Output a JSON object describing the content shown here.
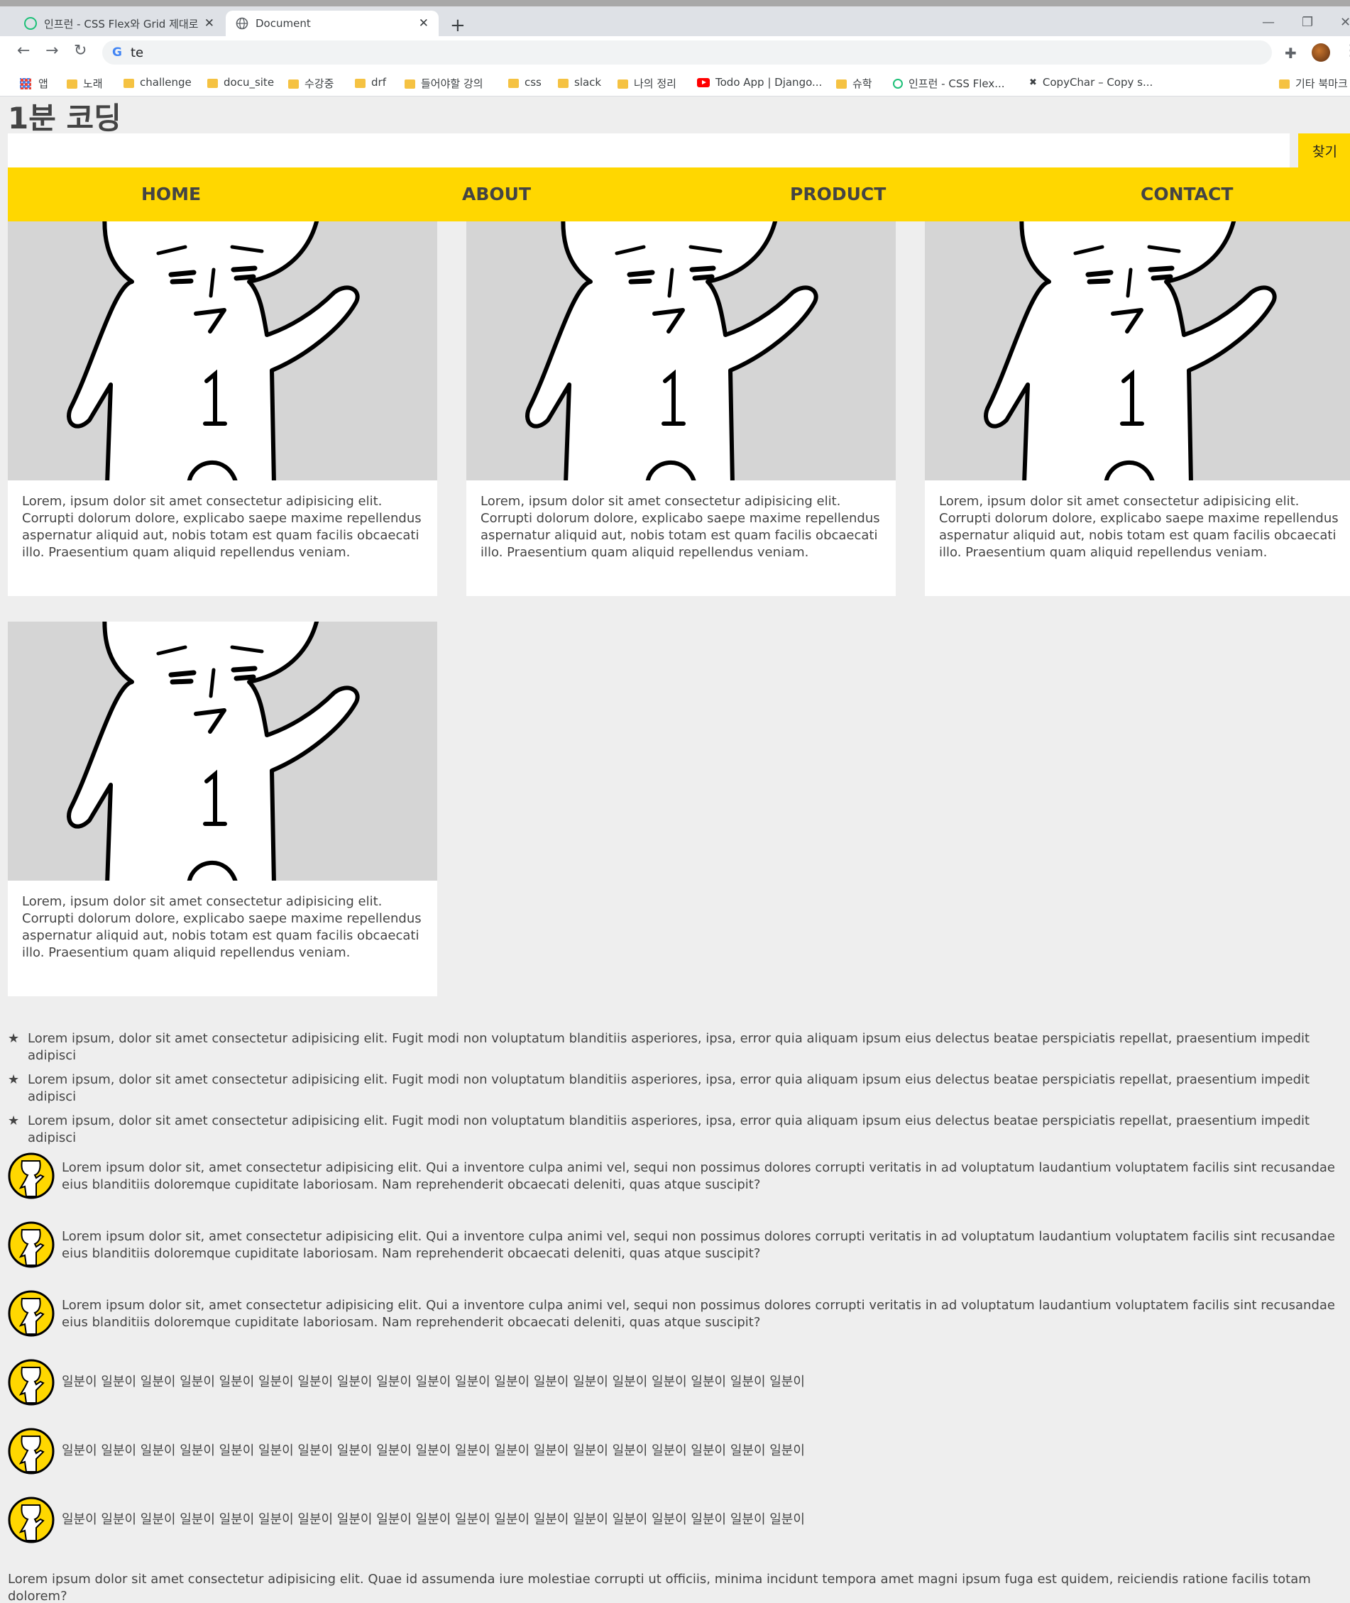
{
  "browser": {
    "tabs": [
      {
        "title": "인프런 - CSS Flex와 Grid 제대로",
        "active": false
      },
      {
        "title": "Document",
        "active": true
      }
    ],
    "address": "te",
    "bookmarks": [
      "앱",
      "노래",
      "challenge",
      "docu_site",
      "수강중",
      "drf",
      "들어야할 강의",
      "css",
      "slack",
      "나의 정리",
      "Todo App | Django...",
      "슈학",
      "인프런 - CSS Flex...",
      "CopyChar – Copy s...",
      "기타 북마크"
    ]
  },
  "page": {
    "title": "1분 코딩",
    "search": {
      "value": "",
      "button": "찾기"
    },
    "nav": [
      "HOME",
      "ABOUT",
      "PRODUCT",
      "CONTACT"
    ],
    "cards": [
      {
        "text": "Lorem, ipsum dolor sit amet consectetur adipisicing elit. Corrupti dolorum dolore, explicabo saepe maxime repellendus aspernatur aliquid aut, nobis totam est quam facilis obcaecati illo. Praesentium quam aliquid repellendus veniam."
      },
      {
        "text": "Lorem, ipsum dolor sit amet consectetur adipisicing elit. Corrupti dolorum dolore, explicabo saepe maxime repellendus aspernatur aliquid aut, nobis totam est quam facilis obcaecati illo. Praesentium quam aliquid repellendus veniam."
      },
      {
        "text": "Lorem, ipsum dolor sit amet consectetur adipisicing elit. Corrupti dolorum dolore, explicabo saepe maxime repellendus aspernatur aliquid aut, nobis totam est quam facilis obcaecati illo. Praesentium quam aliquid repellendus veniam."
      },
      {
        "text": "Lorem, ipsum dolor sit amet consectetur adipisicing elit. Corrupti dolorum dolore, explicabo saepe maxime repellendus aspernatur aliquid aut, nobis totam est quam facilis obcaecati illo. Praesentium quam aliquid repellendus veniam."
      }
    ],
    "star_list": [
      "Lorem ipsum, dolor sit amet consectetur adipisicing elit. Fugit modi non voluptatum blanditiis asperiores, ipsa, error quia aliquam ipsum eius delectus beatae perspiciatis repellat, praesentium impedit adipisci",
      "Lorem ipsum, dolor sit amet consectetur adipisicing elit. Fugit modi non voluptatum blanditiis asperiores, ipsa, error quia aliquam ipsum eius delectus beatae perspiciatis repellat, praesentium impedit adipisci",
      "Lorem ipsum, dolor sit amet consectetur adipisicing elit. Fugit modi non voluptatum blanditiis asperiores, ipsa, error quia aliquam ipsum eius delectus beatae perspiciatis repellat, praesentium impedit adipisci"
    ],
    "avatar_items": [
      "Lorem ipsum dolor sit, amet consectetur adipisicing elit. Qui a inventore culpa animi vel, sequi non possimus dolores corrupti veritatis in ad voluptatum laudantium voluptatem facilis sint recusandae eius blanditiis doloremque cupiditate laboriosam. Nam reprehenderit obcaecati deleniti, quas atque suscipit?",
      "Lorem ipsum dolor sit, amet consectetur adipisicing elit. Qui a inventore culpa animi vel, sequi non possimus dolores corrupti veritatis in ad voluptatum laudantium voluptatem facilis sint recusandae eius blanditiis doloremque cupiditate laboriosam. Nam reprehenderit obcaecati deleniti, quas atque suscipit?",
      "Lorem ipsum dolor sit, amet consectetur adipisicing elit. Qui a inventore culpa animi vel, sequi non possimus dolores corrupti veritatis in ad voluptatum laudantium voluptatem facilis sint recusandae eius blanditiis doloremque cupiditate laboriosam. Nam reprehenderit obcaecati deleniti, quas atque suscipit?",
      "일분이 일분이 일분이 일분이 일분이 일분이 일분이 일분이 일분이 일분이 일분이 일분이 일분이 일분이 일분이 일분이 일분이 일분이 일분이",
      "일분이 일분이 일분이 일분이 일분이 일분이 일분이 일분이 일분이 일분이 일분이 일분이 일분이 일분이 일분이 일분이 일분이 일분이 일분이",
      "일분이 일분이 일분이 일분이 일분이 일분이 일분이 일분이 일분이 일분이 일분이 일분이 일분이 일분이 일분이 일분이 일분이 일분이 일분이"
    ],
    "footer": "Lorem ipsum dolor sit amet consectetur adipisicing elit. Quae id assumenda iure molestiae corrupti ut officiis, minima incidunt tempora amet magni ipsum fuga est quidem, reiciendis ratione facilis totam dolorem?"
  },
  "colors": {
    "accent": "#ffd700",
    "text": "#444444",
    "background": "#eeeeee"
  }
}
